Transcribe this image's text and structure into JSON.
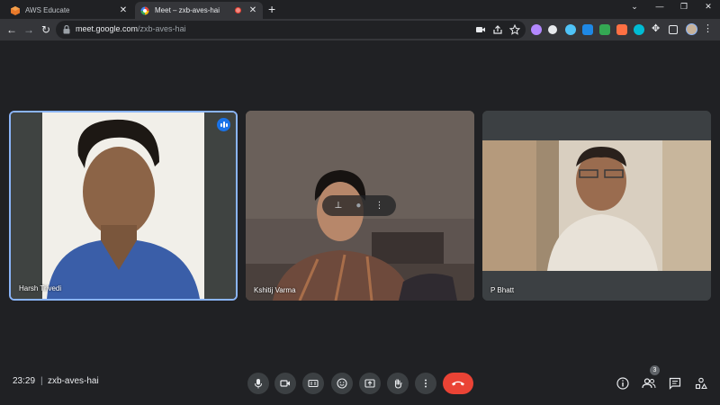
{
  "browser": {
    "tabs": [
      {
        "label": "AWS Educate",
        "icon": "aws-icon",
        "active": false
      },
      {
        "label": "Meet – zxb-aves-hai",
        "icon": "meet-icon",
        "active": true,
        "recording": true
      }
    ],
    "new_tab_label": "+",
    "url_host": "meet.google.com",
    "url_path": "/zxb-aves-hai",
    "window_controls": [
      "minimize",
      "restore",
      "close"
    ]
  },
  "meeting": {
    "time": "23:29",
    "separator": "|",
    "code": "zxb-aves-hai",
    "participant_count": "3",
    "hangup_color": "#ea4335",
    "accent_color": "#1a73e8"
  },
  "participants": [
    {
      "name": "Harsh Trivedi",
      "speaking": true
    },
    {
      "name": "Kshitij Varma",
      "speaking": false,
      "hover_controls": [
        "pin-icon",
        "mute-icon",
        "more-vert-icon"
      ]
    },
    {
      "name": "P Bhatt",
      "speaking": false
    }
  ],
  "controls": [
    "microphone",
    "camera",
    "captions",
    "emoji",
    "present",
    "raise-hand",
    "more-options",
    "leave-call"
  ],
  "side_controls": [
    "meeting-details",
    "people",
    "chat",
    "activities"
  ]
}
